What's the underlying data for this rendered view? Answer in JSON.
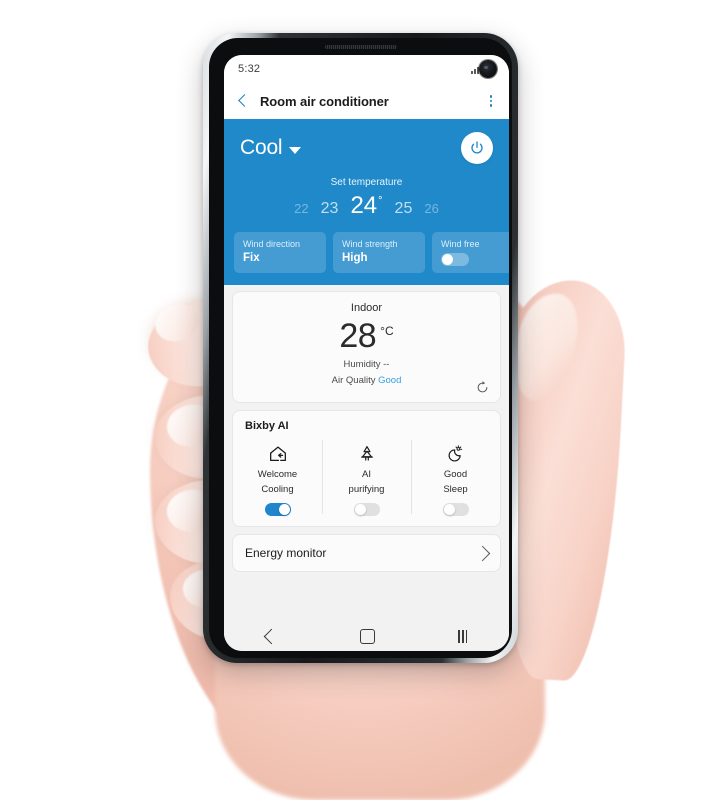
{
  "status_bar": {
    "time": "5:32",
    "signal_icon": "signal-bars-icon",
    "battery_icon": "battery-icon",
    "camera": "punch-hole-camera"
  },
  "app_bar": {
    "back_icon": "back-chevron-icon",
    "title": "Room air conditioner",
    "more_icon": "kebab-menu-icon"
  },
  "control_panel": {
    "accent_color": "#2089ca",
    "mode": "Cool",
    "mode_caret_icon": "chevron-down-icon",
    "power_icon": "power-icon",
    "set_temperature_label": "Set temperature",
    "temperature_scale": [
      {
        "value": "22",
        "state": "far"
      },
      {
        "value": "23",
        "state": "near"
      },
      {
        "value": "24",
        "state": "selected",
        "degree": "°"
      },
      {
        "value": "25",
        "state": "near"
      },
      {
        "value": "26",
        "state": "far"
      }
    ],
    "selected_temperature": "24",
    "chips": [
      {
        "title": "Wind direction",
        "value": "Fix",
        "type": "value"
      },
      {
        "title": "Wind strength",
        "value": "High",
        "type": "value"
      },
      {
        "title": "Wind free",
        "value": "",
        "type": "toggle",
        "toggle_on": false
      }
    ]
  },
  "indoor_card": {
    "title": "Indoor",
    "temperature": "28",
    "unit": "°C",
    "humidity": "Humidity --",
    "air_quality_label": "Air Quality",
    "air_quality_value": "Good",
    "air_quality_color": "#33a0e0",
    "refresh_icon": "refresh-icon"
  },
  "bixby_card": {
    "title": "Bixby AI",
    "items": [
      {
        "icon": "home-arrow-icon",
        "label_line1": "Welcome",
        "label_line2": "Cooling",
        "toggle_on": true
      },
      {
        "icon": "air-purify-tree-icon",
        "label_line1": "AI",
        "label_line2": "purifying",
        "toggle_on": false
      },
      {
        "icon": "moon-sparkle-icon",
        "label_line1": "Good",
        "label_line2": "Sleep",
        "toggle_on": false
      }
    ]
  },
  "energy_card": {
    "label": "Energy monitor",
    "chevron_icon": "chevron-right-icon"
  },
  "nav_bar": {
    "back_icon": "nav-back-icon",
    "home_icon": "nav-home-icon",
    "recents_icon": "nav-recents-icon"
  }
}
